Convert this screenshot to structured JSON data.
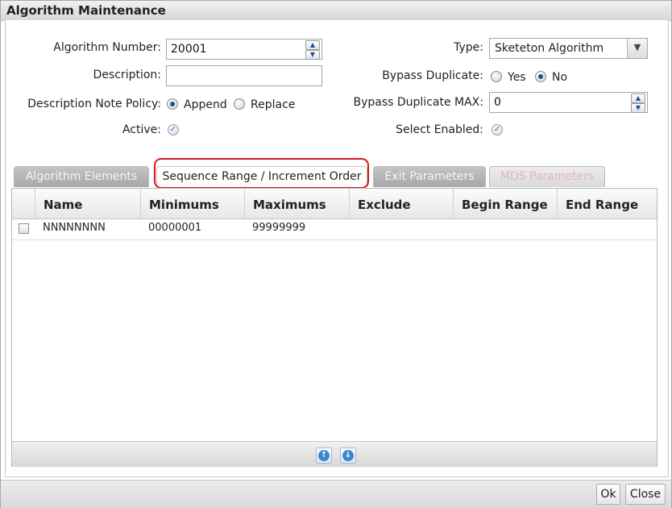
{
  "window": {
    "title": "Algorithm Maintenance"
  },
  "form": {
    "algorithm_number": {
      "label": "Algorithm Number:",
      "value": "20001"
    },
    "description": {
      "label": "Description:",
      "value": ""
    },
    "description_note_policy": {
      "label": "Description Note Policy:",
      "options": [
        "Append",
        "Replace"
      ],
      "selected": "Append"
    },
    "active": {
      "label": "Active:",
      "checked": true
    },
    "type": {
      "label": "Type:",
      "value": "Sketeton Algorithm"
    },
    "bypass_duplicate": {
      "label": "Bypass Duplicate:",
      "options": [
        "Yes",
        "No"
      ],
      "selected": "No"
    },
    "bypass_duplicate_max": {
      "label": "Bypass Duplicate MAX:",
      "value": "0"
    },
    "select_enabled": {
      "label": "Select Enabled:",
      "checked": true
    }
  },
  "tabs": [
    {
      "label": "Algorithm Elements",
      "state": "inactive"
    },
    {
      "label": "Sequence Range / Increment Order",
      "state": "active"
    },
    {
      "label": "Exit Parameters",
      "state": "inactive"
    },
    {
      "label": "MDS Parameters",
      "state": "disabled"
    }
  ],
  "grid": {
    "columns": [
      "Name",
      "Minimums",
      "Maximums",
      "Exclude",
      "Begin Range",
      "End Range"
    ],
    "rows": [
      {
        "name": "NNNNNNNN",
        "minimums": "00000001",
        "maximums": "99999999",
        "exclude": "",
        "begin_range": "",
        "end_range": ""
      }
    ]
  },
  "footer": {
    "ok_label": "Ok",
    "close_label": "Close"
  },
  "icons": {
    "spin_up": "spin-up-icon",
    "spin_down": "spin-down-icon",
    "move_up": "arrow-up-icon",
    "move_down": "arrow-down-icon"
  },
  "colors": {
    "highlight": "#d21a1a",
    "radio_selected": "#1a4f94",
    "arrow_button": "#3b86d0"
  }
}
